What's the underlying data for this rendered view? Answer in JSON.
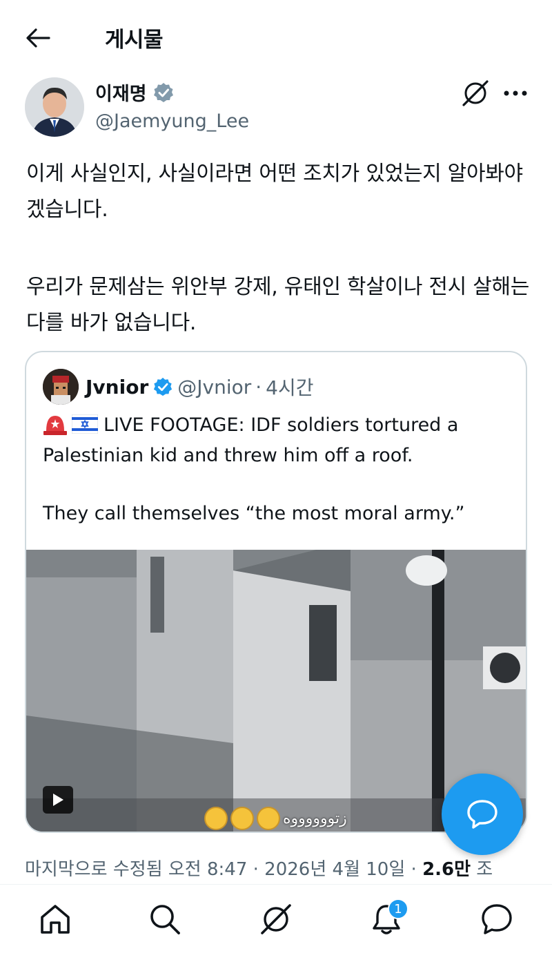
{
  "header": {
    "title": "게시물"
  },
  "author": {
    "name": "이재명",
    "handle": "@Jaemyung_Lee"
  },
  "post": {
    "paragraphs": [
      "이게 사실인지, 사실이라면 어떤 조치가 있었는지 알아봐야겠습니다.",
      "우리가 문제삼는 위안부 강제, 유태인 학살이나 전시 살해는 다를 바가 없습니다."
    ]
  },
  "quote": {
    "name": "Jvnior",
    "handle": "@Jvnior",
    "separator": "·",
    "time": "4시간",
    "line1": "LIVE FOOTAGE: IDF soldiers tortured a Palestinian kid and threw him off a roof.",
    "line2": "They call themselves “the most moral army.”",
    "video_caption": "زتووووووه"
  },
  "meta": {
    "edited": "마지막으로 수정됨 오전 8:47 · 2026년 4월 10일 · ",
    "views": "2.6만",
    "views_suffix": " 조"
  },
  "nav": {
    "notification_badge": "1"
  },
  "colors": {
    "accent": "#1d9bf0",
    "text": "#0f1419",
    "secondary": "#536471",
    "border": "#cfd9de"
  }
}
